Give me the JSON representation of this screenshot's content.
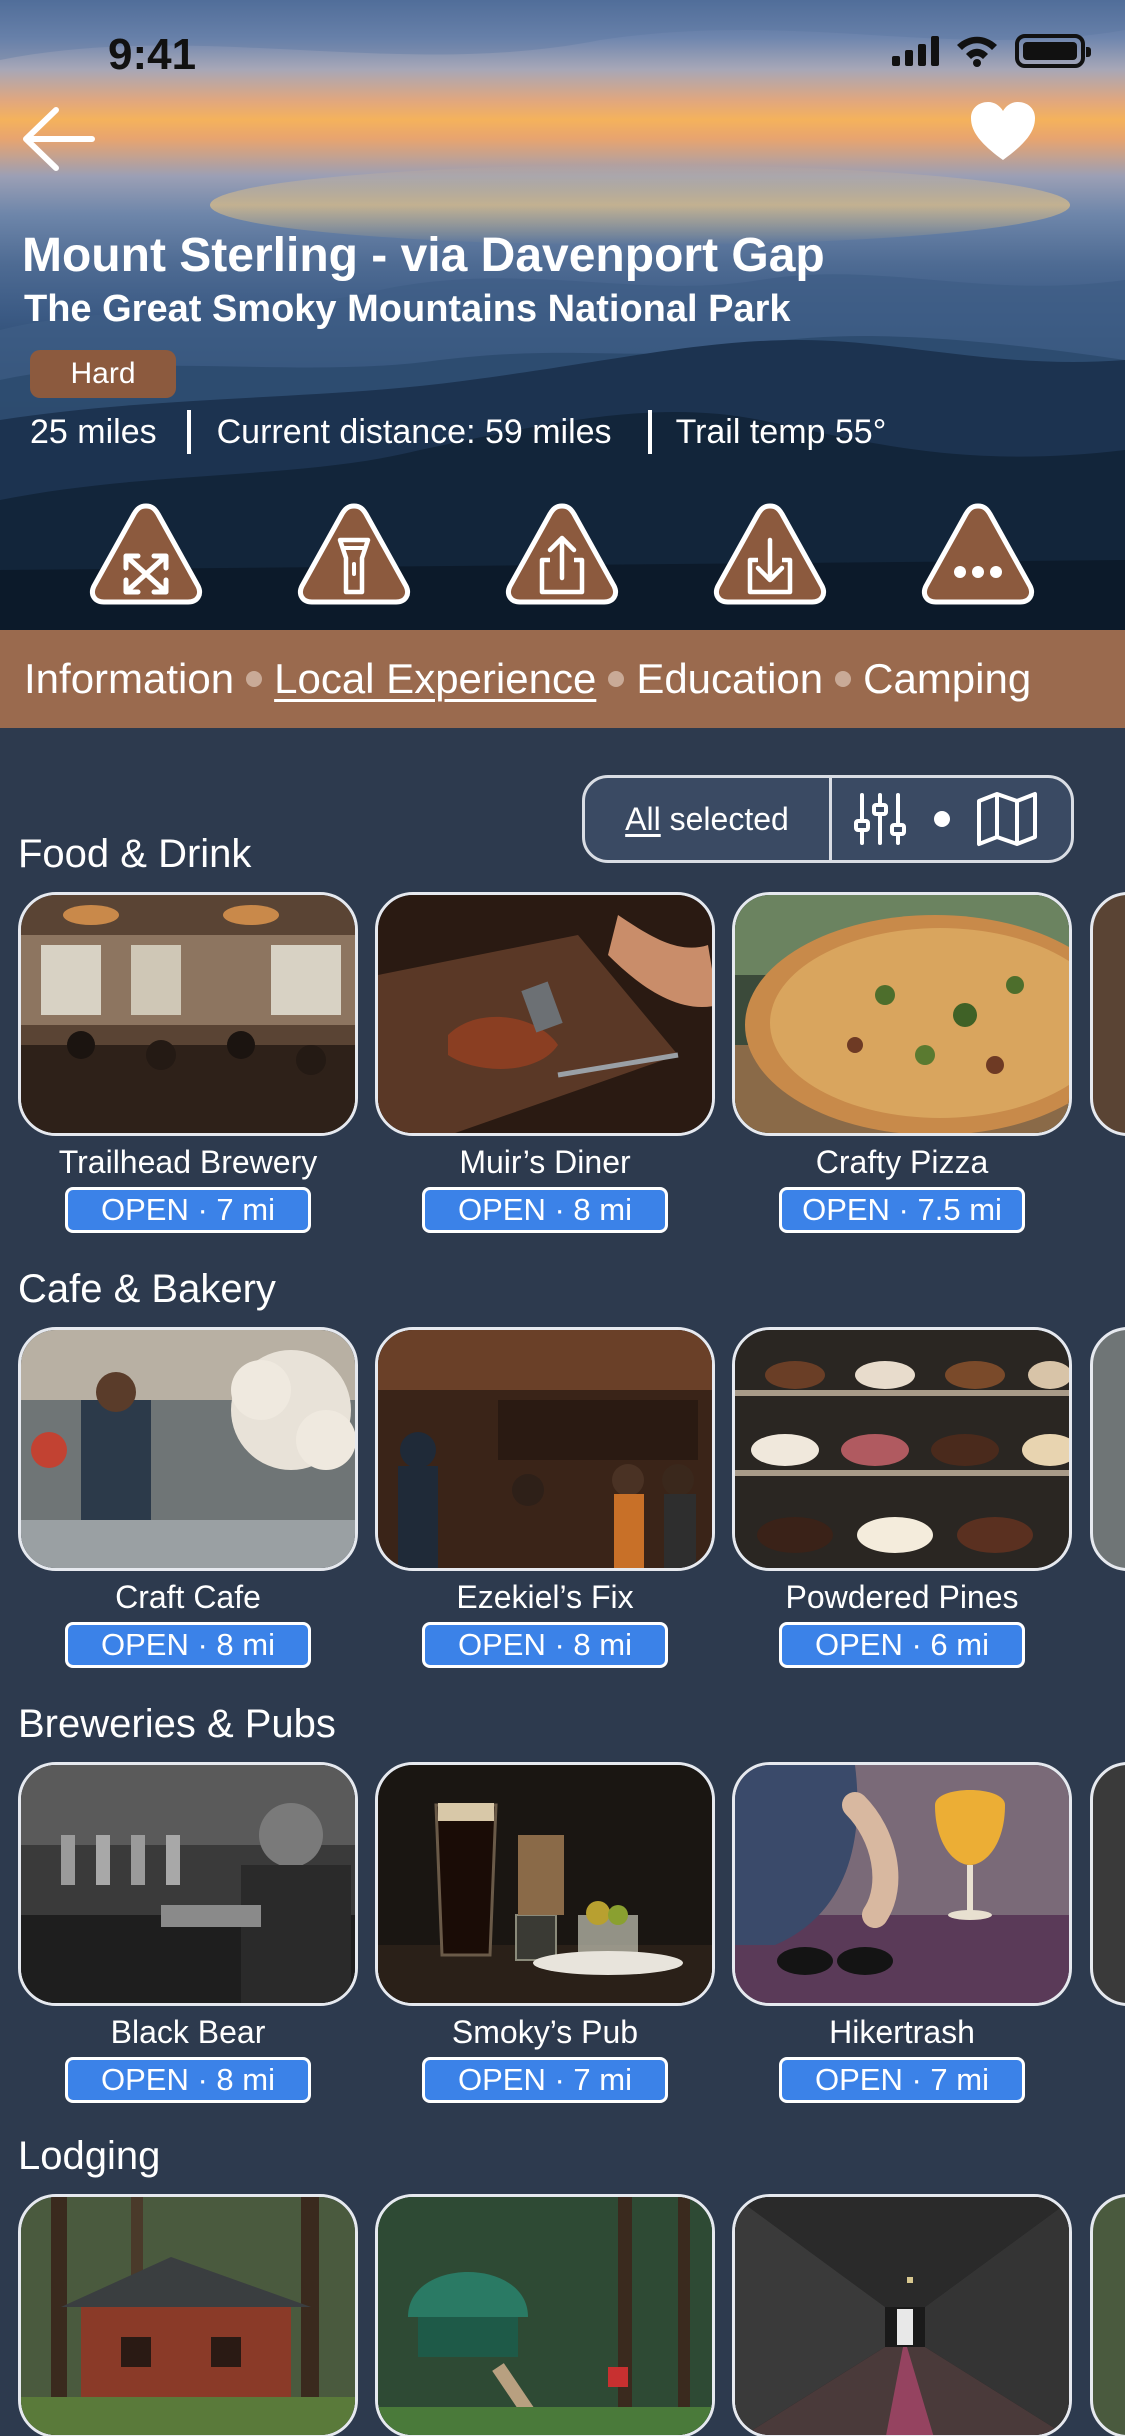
{
  "status_bar": {
    "time": "9:41"
  },
  "header": {
    "trail_name": "Mount Sterling - via Davenport Gap",
    "park_name": "The Great Smoky Mountains National Park",
    "difficulty": "Hard",
    "length": "25 miles",
    "current_distance": "Current distance: 59 miles",
    "trail_temp": "Trail temp 55°"
  },
  "actions": [
    "expand-icon",
    "flashlight-icon",
    "share-icon",
    "download-icon",
    "more-icon"
  ],
  "tabs": [
    {
      "label": "Information",
      "active": false
    },
    {
      "label": "Local Experience",
      "active": true
    },
    {
      "label": "Education",
      "active": false
    },
    {
      "label": "Camping",
      "active": false
    }
  ],
  "filter": {
    "all": "All",
    "selected": " selected"
  },
  "sections": [
    {
      "title": "Food & Drink",
      "cards": [
        {
          "name": "Trailhead Brewery",
          "status": "OPEN · 7 mi"
        },
        {
          "name": "Muir’s Diner",
          "status": "OPEN · 8 mi"
        },
        {
          "name": "Crafty Pizza",
          "status": "OPEN · 7.5 mi"
        }
      ]
    },
    {
      "title": "Cafe & Bakery",
      "cards": [
        {
          "name": "Craft Cafe",
          "status": "OPEN · 8 mi"
        },
        {
          "name": "Ezekiel’s Fix",
          "status": "OPEN · 8 mi"
        },
        {
          "name": "Powdered Pines",
          "status": "OPEN · 6 mi"
        }
      ]
    },
    {
      "title": "Breweries & Pubs",
      "cards": [
        {
          "name": "Black Bear",
          "status": "OPEN · 8 mi"
        },
        {
          "name": "Smoky’s Pub",
          "status": "OPEN · 7 mi"
        },
        {
          "name": "Hikertrash",
          "status": "OPEN · 7 mi"
        }
      ]
    },
    {
      "title": "Lodging",
      "cards": [
        {
          "name": "",
          "status": ""
        },
        {
          "name": "",
          "status": ""
        },
        {
          "name": "",
          "status": ""
        }
      ]
    }
  ],
  "colors": {
    "background": "#2d3a4e",
    "tab_bar": "#9a6a4e",
    "badge_blue": "#3b82e8",
    "difficulty": "#8c5a3e"
  }
}
